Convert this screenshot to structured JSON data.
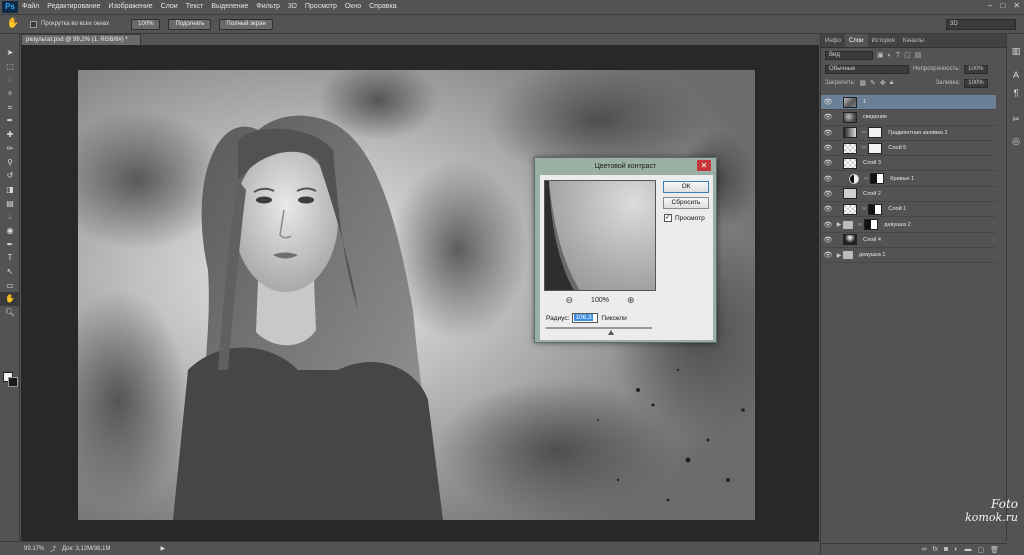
{
  "app": {
    "logo": "Ps"
  },
  "menu": [
    "Файл",
    "Редактирование",
    "Изображение",
    "Слои",
    "Текст",
    "Выделение",
    "Фильтр",
    "3D",
    "Просмотр",
    "Окно",
    "Справка"
  ],
  "window_controls": [
    "–",
    "□",
    "✕"
  ],
  "options_bar": {
    "scroll_all_label": "Прокрутка во всех окнах",
    "buttons": [
      "100%",
      "Подогнать",
      "Полный экран"
    ],
    "workspace": "3D"
  },
  "document": {
    "tab_title": "результат.psd @ 99,2% (1, RGB/8#) *",
    "zoom": "99.17%",
    "doc_info": "Док: 3,12M/36,1M"
  },
  "tools": [
    "move-tool",
    "marquee-tool",
    "lasso-tool",
    "quick-select-tool",
    "crop-tool",
    "eyedropper-tool",
    "healing-tool",
    "brush-tool",
    "stamp-tool",
    "history-brush-tool",
    "eraser-tool",
    "gradient-tool",
    "blur-tool",
    "dodge-tool",
    "pen-tool",
    "type-tool",
    "path-select-tool",
    "shape-tool",
    "hand-tool",
    "zoom-tool"
  ],
  "colors": {
    "foreground": "#f2f2f2",
    "background": "#1a1a1a",
    "selection": "#6b7f97",
    "dialog_frame": "#9bb0a4",
    "close": "#c5363a"
  },
  "panel": {
    "tabs": [
      "Инфо",
      "Слои",
      "История",
      "Каналы"
    ],
    "active_tab": "Слои",
    "filter_label": "Вид",
    "blend_mode": "Обычные",
    "opacity_label": "Непрозрачность:",
    "opacity_value": "100%",
    "lock_label": "Закрепить:",
    "fill_label": "Заливка:",
    "fill_value": "100%",
    "layers": [
      {
        "name": "1",
        "thumb": "photo",
        "selected": true
      },
      {
        "name": "сведение",
        "thumb": "smoke"
      },
      {
        "name": "Градиентная заливка 1",
        "thumb": "grad",
        "mask": "white",
        "chain": true
      },
      {
        "name": "Слой 5",
        "thumb": "check",
        "mask": "white",
        "chain": true
      },
      {
        "name": "Слой 3",
        "thumb": "check"
      },
      {
        "name": "Кривые 1",
        "adjustment": true,
        "mask": "mask",
        "chain": true,
        "indent": true
      },
      {
        "name": "Слой 2",
        "thumb": "gray"
      },
      {
        "name": "Слой 1",
        "thumb": "check",
        "mask": "mask",
        "chain": true
      },
      {
        "name": "девушка 2",
        "folder": true,
        "mask": "mask",
        "chain": true,
        "collapsed": true
      },
      {
        "name": "Слой 4",
        "thumb": "girl"
      },
      {
        "name": "девушка 1",
        "folder": true,
        "collapsed": true
      }
    ],
    "footer_icons": [
      "link-icon",
      "fx-icon",
      "mask-icon",
      "adjustment-icon",
      "folder-icon",
      "new-layer-icon",
      "trash-icon"
    ]
  },
  "dialog": {
    "title": "Цветовой контраст",
    "ok": "ОК",
    "reset": "Сбросить",
    "preview_label": "Просмотр",
    "preview_checked": true,
    "zoom": "100%",
    "radius_label": "Радиус:",
    "radius_value": "106,3",
    "radius_unit": "Пиксели",
    "slider_level": 0.58
  },
  "watermark": {
    "line1": "Foto",
    "line2": "komok.ru"
  }
}
